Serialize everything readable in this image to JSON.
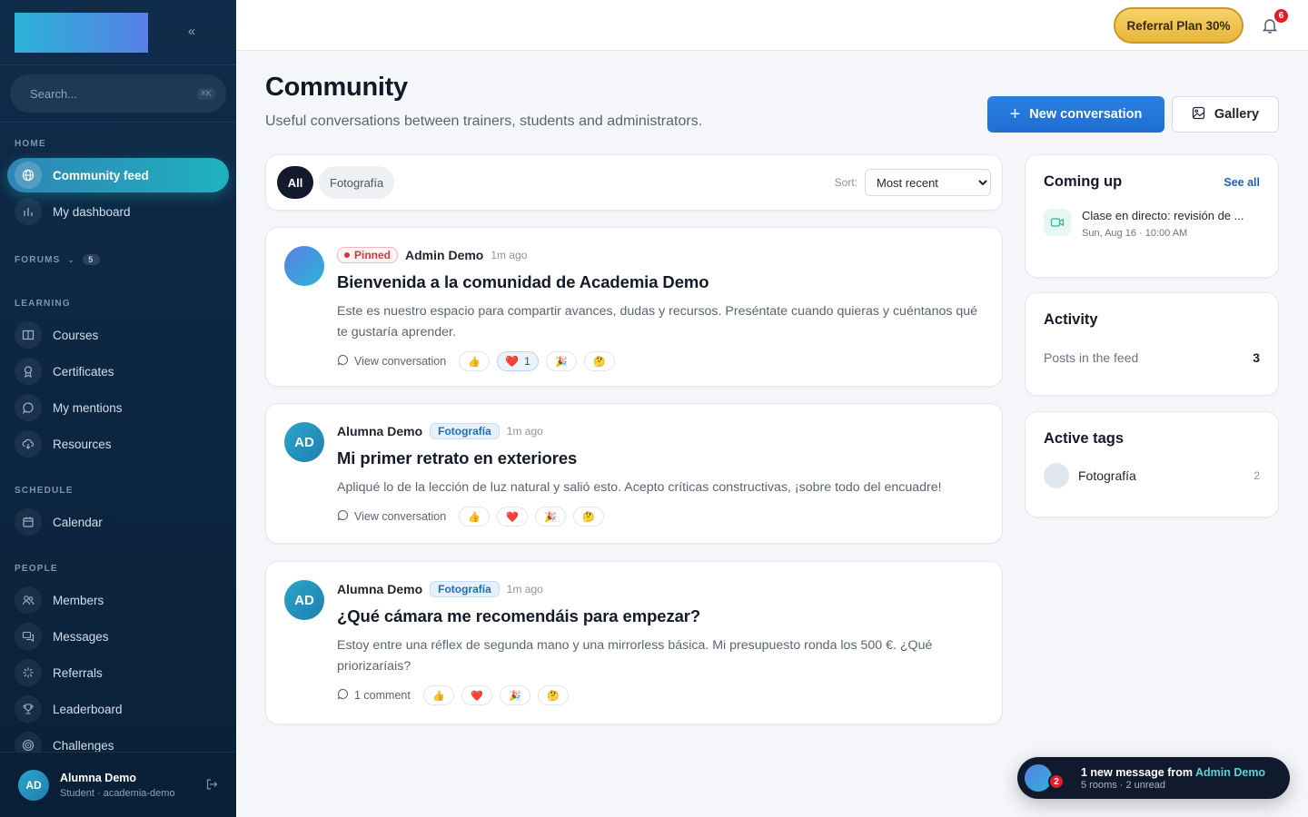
{
  "sidebar": {
    "search_placeholder": "Search...",
    "search_shortcut": "⌘K",
    "sections": {
      "home": "HOME",
      "forums": "FORUMS",
      "forums_count": "5",
      "learning": "LEARNING",
      "schedule": "SCHEDULE",
      "people": "PEOPLE"
    },
    "items": {
      "community_feed": "Community feed",
      "my_dashboard": "My dashboard",
      "courses": "Courses",
      "certificates": "Certificates",
      "my_mentions": "My mentions",
      "resources": "Resources",
      "calendar": "Calendar",
      "members": "Members",
      "messages": "Messages",
      "referrals": "Referrals",
      "leaderboard": "Leaderboard",
      "challenges": "Challenges"
    },
    "user": {
      "initials": "AD",
      "name": "Alumna Demo",
      "role": "Student · academia-demo"
    }
  },
  "header": {
    "referral_label": "Referral Plan 30%",
    "notifications_count": "6"
  },
  "page": {
    "title": "Community",
    "subtitle": "Useful conversations between trainers, students and administrators.",
    "new_conversation_label": "New conversation",
    "gallery_label": "Gallery"
  },
  "filters": {
    "all_label": "All",
    "tag_label": "Fotografía",
    "sort_label": "Sort:",
    "sort_value": "Most recent",
    "sort_options": [
      "Most recent"
    ]
  },
  "posts": [
    {
      "pinned_label": "Pinned",
      "author": "Admin Demo",
      "time": "1m ago",
      "title": "Bienvenida a la comunidad de Academia Demo",
      "body": "Este es nuestro espacio para compartir avances, dudas y recursos. Preséntate cuando quieras y cuéntanos qué te gustaría aprender.",
      "action_label": "View conversation",
      "reactions": [
        "👍",
        "❤️",
        "🎉",
        "🤔"
      ],
      "heart_count": "1"
    },
    {
      "initials": "AD",
      "author": "Alumna Demo",
      "tag": "Fotografía",
      "time": "1m ago",
      "title": "Mi primer retrato en exteriores",
      "body": "Apliqué lo de la lección de luz natural y salió esto. Acepto críticas constructivas, ¡sobre todo del encuadre!",
      "action_label": "View conversation",
      "reactions": [
        "👍",
        "❤️",
        "🎉",
        "🤔"
      ]
    },
    {
      "initials": "AD",
      "author": "Alumna Demo",
      "tag": "Fotografía",
      "time": "1m ago",
      "title": "¿Qué cámara me recomendáis para empezar?",
      "body": "Estoy entre una réflex de segunda mano y una mirrorless básica. Mi presupuesto ronda los 500 €. ¿Qué priorizaríais?",
      "action_label": "1 comment",
      "reactions": [
        "👍",
        "❤️",
        "🎉",
        "🤔"
      ]
    }
  ],
  "coming_up": {
    "title": "Coming up",
    "see_all": "See all",
    "event_title": "Clase en directo: revisión de ...",
    "event_date": "Sun, Aug 16 · 10:00 AM"
  },
  "activity": {
    "title": "Activity",
    "label": "Posts in the feed",
    "value": "3"
  },
  "active_tags": {
    "title": "Active tags",
    "tag": "Fotografía",
    "count": "2"
  },
  "toast": {
    "badge": "2",
    "text_prefix": "1 new message from",
    "from": "Admin Demo",
    "sub": "5 rooms · 2 unread"
  },
  "colors": {
    "accent": "#1e6fd3",
    "sidebar_bg": "#0f2c4a",
    "active_nav": "#1fb2bf",
    "referral": "#e8b53a",
    "danger": "#e11d2a"
  }
}
